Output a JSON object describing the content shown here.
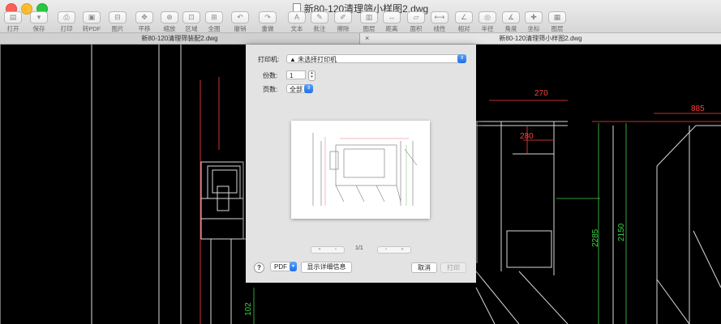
{
  "window": {
    "title": "新80-120清理筛小样图2.dwg"
  },
  "toolbar": {
    "items": [
      {
        "label": "打开",
        "icon": "folder-icon",
        "glyph": "▤"
      },
      {
        "label": "保存",
        "icon": "save-icon",
        "glyph": "▾"
      },
      {
        "label": "打印",
        "icon": "printer-icon",
        "glyph": "⎙"
      },
      {
        "label": "转PDF",
        "icon": "pdf-icon",
        "glyph": "▣"
      },
      {
        "label": "图片",
        "icon": "image-icon",
        "glyph": "⊟"
      },
      {
        "label": "平移",
        "icon": "pan-icon",
        "glyph": "✥"
      },
      {
        "label": "缩放",
        "icon": "zoom-icon",
        "glyph": "⊕"
      },
      {
        "label": "区域",
        "icon": "zoom-window-icon",
        "glyph": "⊡"
      },
      {
        "label": "全图",
        "icon": "zoom-extents-icon",
        "glyph": "⊞"
      },
      {
        "label": "撤销",
        "icon": "undo-icon",
        "glyph": "↶"
      },
      {
        "label": "重做",
        "icon": "redo-icon",
        "glyph": "↷"
      },
      {
        "label": "文本",
        "icon": "text-icon",
        "glyph": "A"
      },
      {
        "label": "批注",
        "icon": "annotation-icon",
        "glyph": "✎"
      },
      {
        "label": "擦除",
        "icon": "eraser-icon",
        "glyph": "✐"
      },
      {
        "label": "图层",
        "icon": "layers-icon",
        "glyph": "▥"
      },
      {
        "label": "距离",
        "icon": "distance-icon",
        "glyph": "↔"
      },
      {
        "label": "面积",
        "icon": "area-icon",
        "glyph": "▱"
      },
      {
        "label": "线性",
        "icon": "linear-dim-icon",
        "glyph": "⟷"
      },
      {
        "label": "相对",
        "icon": "relative-dim-icon",
        "glyph": "∠"
      },
      {
        "label": "半径",
        "icon": "radius-icon",
        "glyph": "◎"
      },
      {
        "label": "角度",
        "icon": "angle-icon",
        "glyph": "∡"
      },
      {
        "label": "坐标",
        "icon": "coordinate-icon",
        "glyph": "✚"
      },
      {
        "label": "图层",
        "icon": "layers-icon",
        "glyph": "▦"
      }
    ]
  },
  "tabs": [
    {
      "label": "新80-120清理筛装配2.dwg",
      "active": false
    },
    {
      "label": "新80-120清理筛小样图2.dwg",
      "active": true
    }
  ],
  "print_dialog": {
    "printer_label": "打印机:",
    "printer_value": "▲ 未选择打印机",
    "copies_label": "份数:",
    "copies_value": "1",
    "pages_label": "页数:",
    "pages_value": "全部",
    "page_indicator": "1/1",
    "help": "?",
    "pdf_label": "PDF",
    "details_label": "显示详细信息",
    "cancel_label": "取消",
    "print_label": "打印"
  },
  "drawing": {
    "dimensions_red": [
      "270",
      "280",
      "885"
    ],
    "dimensions_green": [
      "2285",
      "2150",
      "102"
    ]
  },
  "colors": {
    "canvas": "#000000",
    "dimension_red": "#ff4040",
    "dimension_green": "#3fd04a"
  }
}
